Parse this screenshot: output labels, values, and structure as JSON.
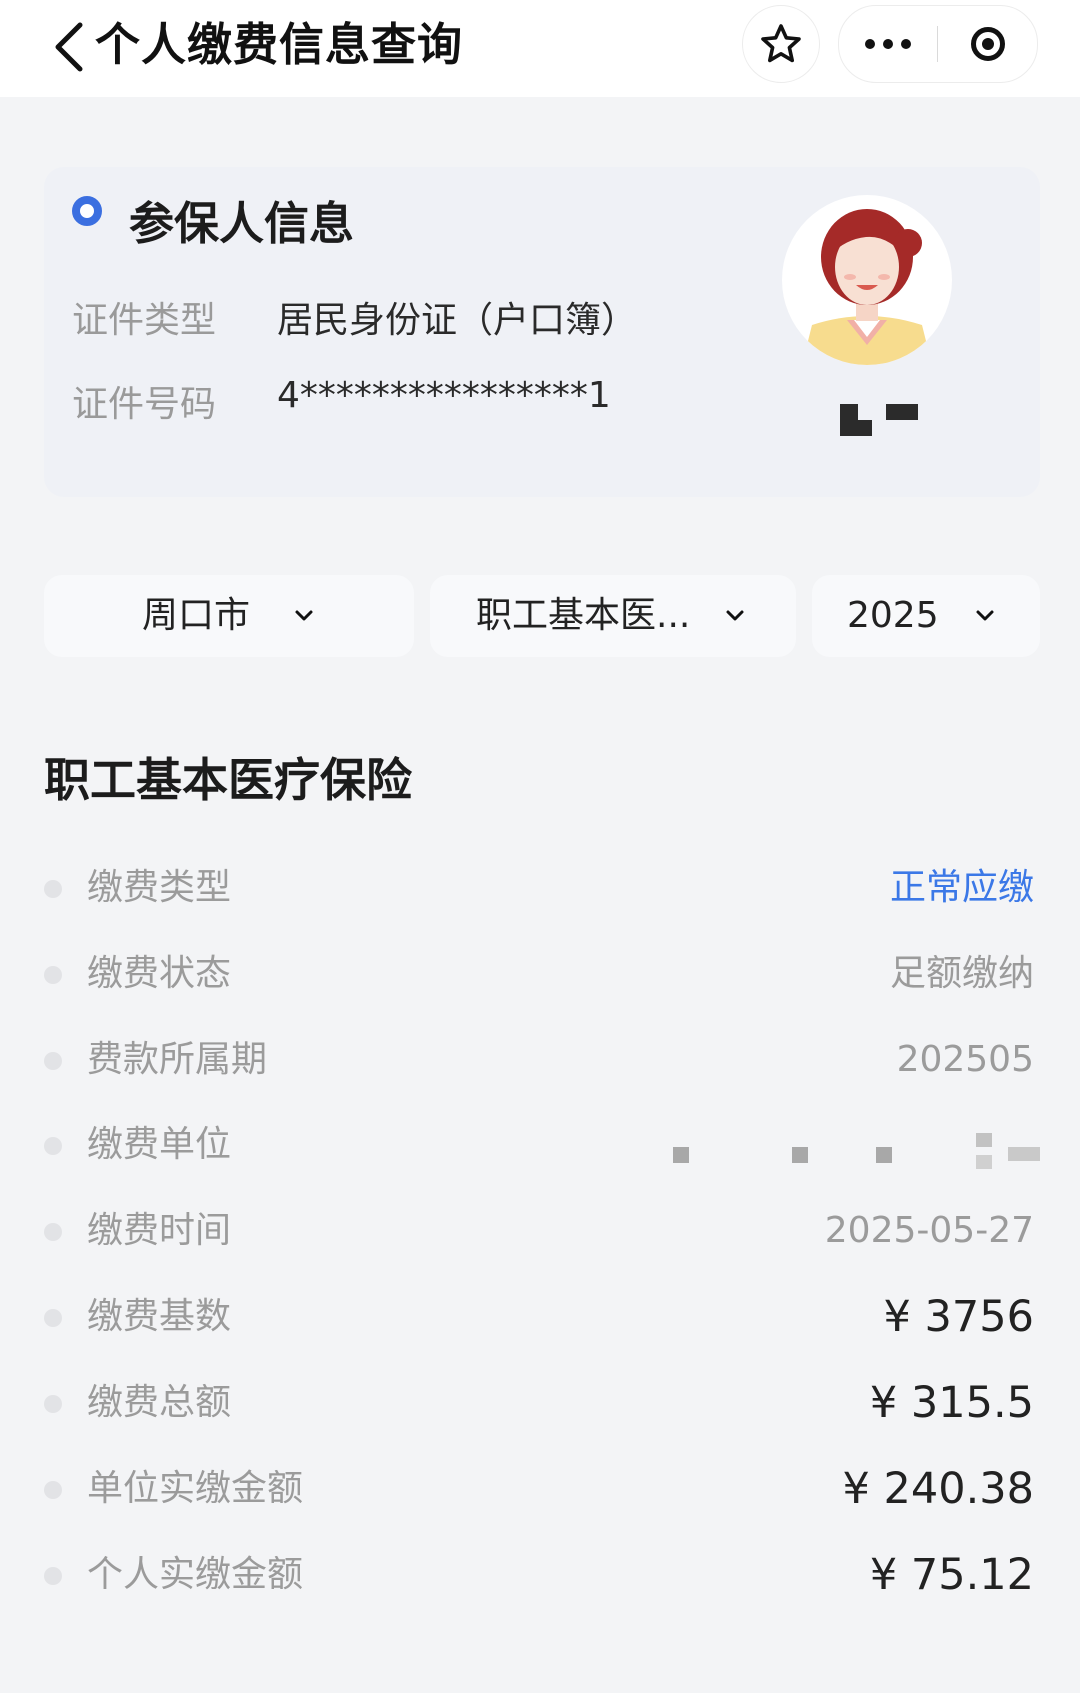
{
  "nav": {
    "title": "个人缴费信息查询",
    "back_icon": "chevron-left-icon",
    "favorite_icon": "star-icon",
    "more_icon": "more-dots-icon",
    "close_icon": "target-close-icon"
  },
  "insured": {
    "title": "参保人信息",
    "id_type_label": "证件类型",
    "id_type_value": "居民身份证（户口簿）",
    "id_number_label": "证件号码",
    "id_number_value": "4****************1",
    "avatar_icon": "female-avatar-icon"
  },
  "filters": [
    {
      "value": "周口市"
    },
    {
      "value": "职工基本医..."
    },
    {
      "value": "2025"
    }
  ],
  "section": {
    "title": "职工基本医疗保险"
  },
  "details": [
    {
      "label": "缴费类型",
      "value": "正常应缴"
    },
    {
      "label": "缴费状态",
      "value": "足额缴纳"
    },
    {
      "label": "费款所属期",
      "value": "202505"
    },
    {
      "label": "缴费单位",
      "value": ""
    },
    {
      "label": "缴费时间",
      "value": "2025-05-27"
    },
    {
      "label": "缴费基数",
      "value": "¥ 3756"
    },
    {
      "label": "缴费总额",
      "value": "¥ 315.5"
    },
    {
      "label": "单位实缴金额",
      "value": "¥ 240.38"
    },
    {
      "label": "个人实缴金额",
      "value": "¥ 75.12"
    }
  ],
  "colors": {
    "accent_blue": "#3b78e7",
    "dot_blue": "#3b6fe0",
    "background": "#f3f4f6"
  }
}
